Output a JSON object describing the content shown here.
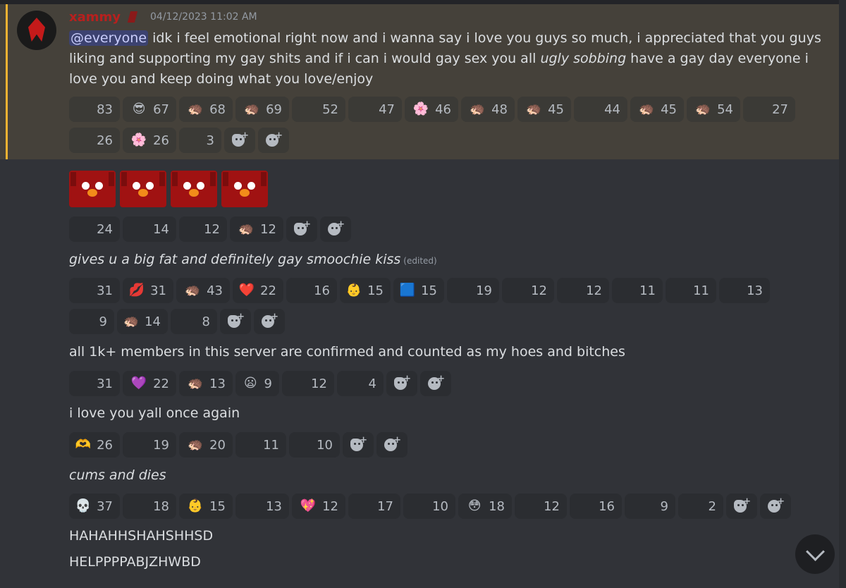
{
  "message": {
    "username": "xammy",
    "timestamp": "04/12/2023 11:02 AM",
    "mention": "@everyone",
    "body_before": " idk i feel emotional right now and i wanna say i love you guys so much, i appreciated that you guys liking and supporting my gay shits and if i can i would gay sex you all ",
    "body_italic": "ugly sobbing",
    "body_after": " have a gay day everyone i love you and keep doing what you love/enjoy"
  },
  "reactions1_row1": [
    {
      "emoji": "",
      "count": "83",
      "w": 72
    },
    {
      "emoji": "😎",
      "count": "67",
      "w": 76
    },
    {
      "emoji": "🦔",
      "count": "68",
      "w": 76
    },
    {
      "emoji": "🦔",
      "count": "69",
      "w": 76
    },
    {
      "emoji": "",
      "count": "52",
      "w": 76
    },
    {
      "emoji": "",
      "count": "47",
      "w": 76
    },
    {
      "emoji": "🌸",
      "count": "46",
      "w": 76
    },
    {
      "emoji": "🦔",
      "count": "48",
      "w": 76
    },
    {
      "emoji": "🦔",
      "count": "45",
      "w": 76
    },
    {
      "emoji": "",
      "count": "44",
      "w": 76
    },
    {
      "emoji": "🦔",
      "count": "45",
      "w": 76
    },
    {
      "emoji": "🦔",
      "count": "54",
      "w": 76
    },
    {
      "emoji": "",
      "count": "27",
      "w": 74
    }
  ],
  "reactions1_row2": [
    {
      "emoji": "",
      "count": "26",
      "w": 72
    },
    {
      "emoji": "🌸",
      "count": "26",
      "w": 76
    },
    {
      "emoji": "",
      "count": "3",
      "w": 60
    }
  ],
  "reactions2": [
    {
      "emoji": "",
      "count": "24",
      "w": 72
    },
    {
      "emoji": "",
      "count": "14",
      "w": 76
    },
    {
      "emoji": "",
      "count": "12",
      "w": 68
    },
    {
      "emoji": "🦔",
      "count": "12",
      "w": 76
    }
  ],
  "msg3": {
    "text": "gives u a big fat and definitely gay smoochie kiss",
    "edited": "(edited)"
  },
  "reactions3_row1": [
    {
      "emoji": "",
      "count": "31",
      "w": 72
    },
    {
      "emoji": "💋",
      "count": "31",
      "w": 72
    },
    {
      "emoji": "🦔",
      "count": "43",
      "w": 76
    },
    {
      "emoji": "❤️",
      "count": "22",
      "w": 72
    },
    {
      "emoji": "",
      "count": "16",
      "w": 72
    },
    {
      "emoji": "👶",
      "count": "15",
      "w": 72
    },
    {
      "emoji": "🟦",
      "count": "15",
      "w": 72
    },
    {
      "emoji": "",
      "count": "19",
      "w": 74
    },
    {
      "emoji": "",
      "count": "12",
      "w": 74
    },
    {
      "emoji": "",
      "count": "12",
      "w": 74
    },
    {
      "emoji": "",
      "count": "11",
      "w": 72
    },
    {
      "emoji": "",
      "count": "11",
      "w": 72
    },
    {
      "emoji": "",
      "count": "13",
      "w": 72
    }
  ],
  "reactions3_row2": [
    {
      "emoji": "",
      "count": "9",
      "w": 64
    },
    {
      "emoji": "🦔",
      "count": "14",
      "w": 72
    },
    {
      "emoji": "",
      "count": "8",
      "w": 66
    }
  ],
  "msg4": {
    "text": "all 1k+ members in this server are confirmed and counted as my hoes and bitches"
  },
  "reactions4": [
    {
      "emoji": "",
      "count": "31",
      "w": 72
    },
    {
      "emoji": "💜",
      "count": "22",
      "w": 76
    },
    {
      "emoji": "🦔",
      "count": "13",
      "w": 76
    },
    {
      "emoji": "😦",
      "count": "9",
      "w": 62
    },
    {
      "emoji": "",
      "count": "12",
      "w": 74
    },
    {
      "emoji": "",
      "count": "4",
      "w": 66
    }
  ],
  "msg5": {
    "text": "i love you yall once again"
  },
  "reactions5": [
    {
      "emoji": "🫶",
      "count": "26",
      "w": 72
    },
    {
      "emoji": "",
      "count": "19",
      "w": 76
    },
    {
      "emoji": "🦔",
      "count": "20",
      "w": 76
    },
    {
      "emoji": "",
      "count": "11",
      "w": 72
    },
    {
      "emoji": "",
      "count": "10",
      "w": 72
    }
  ],
  "msg6": {
    "text": "cums and dies"
  },
  "reactions6": [
    {
      "emoji": "💀",
      "count": "37",
      "w": 72
    },
    {
      "emoji": "",
      "count": "18",
      "w": 76
    },
    {
      "emoji": "👶",
      "count": "15",
      "w": 76
    },
    {
      "emoji": "",
      "count": "13",
      "w": 76
    },
    {
      "emoji": "💖",
      "count": "12",
      "w": 76
    },
    {
      "emoji": "",
      "count": "17",
      "w": 74
    },
    {
      "emoji": "",
      "count": "10",
      "w": 74
    },
    {
      "emoji": "😳",
      "count": "18",
      "w": 76
    },
    {
      "emoji": "",
      "count": "12",
      "w": 74
    },
    {
      "emoji": "",
      "count": "16",
      "w": 74
    },
    {
      "emoji": "",
      "count": "9",
      "w": 72
    },
    {
      "emoji": "",
      "count": "2",
      "w": 64
    }
  ],
  "msg7": {
    "text": "HAHAHHSHAHSHHSD"
  },
  "msg8": {
    "text": "HELPPPPABJZHWBD"
  },
  "icons": {
    "add_reaction": "add-reaction-icon",
    "add_super_reaction": "add-super-reaction-icon",
    "jump_to_present": "chevron-down-icon"
  },
  "colors": {
    "username": "#b8201e",
    "highlight_bg": "#45413a",
    "highlight_bar": "#f0b232",
    "mention_bg": "#3c4270"
  }
}
